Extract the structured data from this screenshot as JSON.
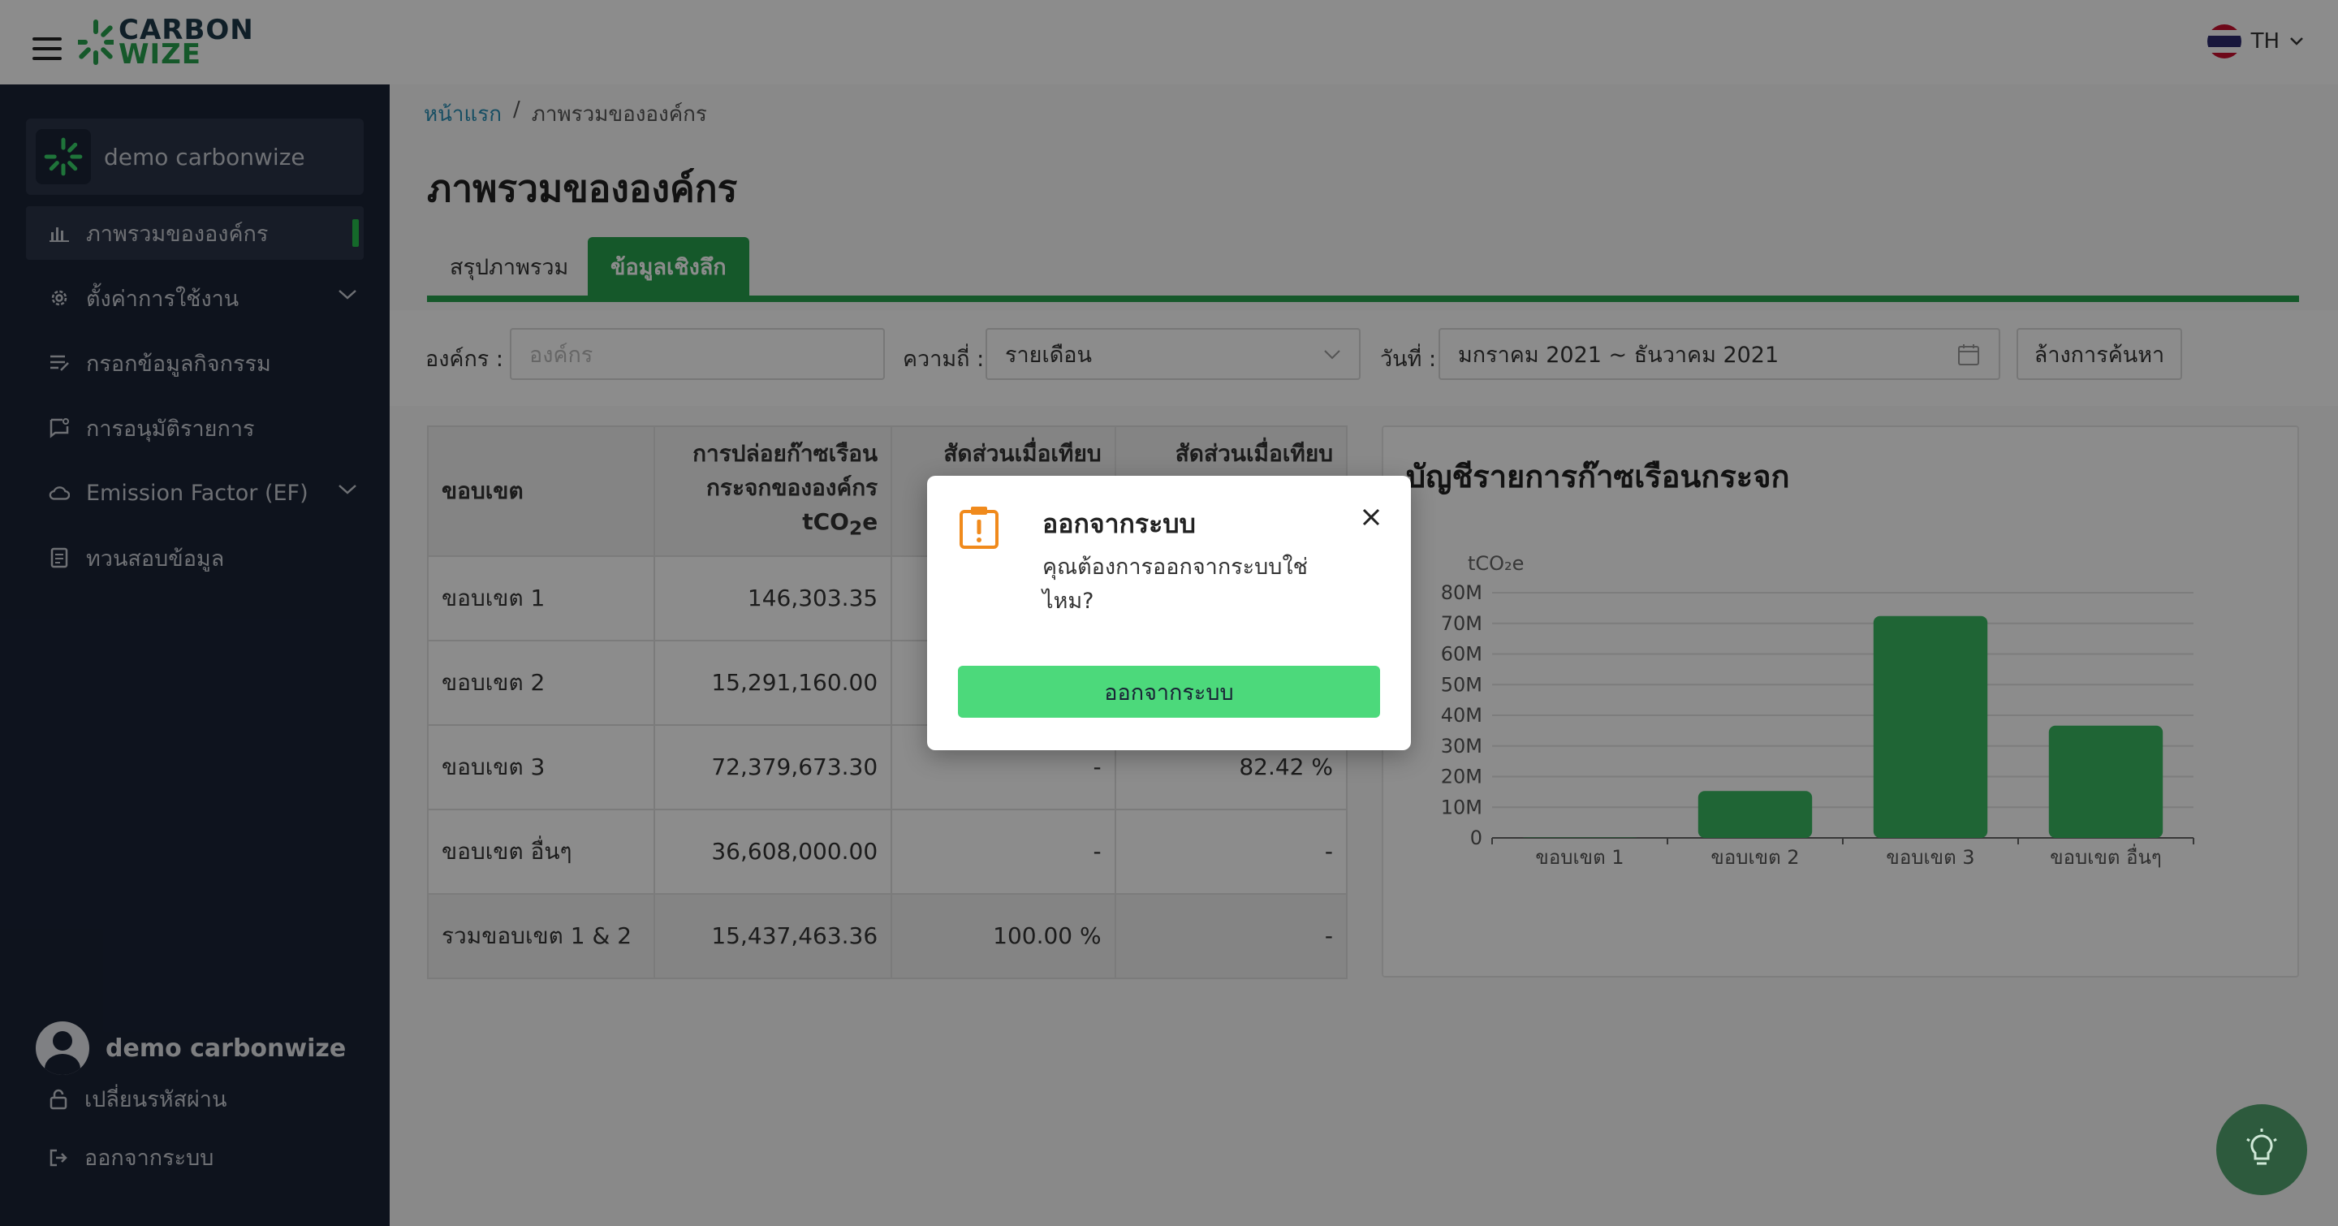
{
  "brand": {
    "line1": "CARBON",
    "line2": "WIZE",
    "accent": "#27a04d",
    "dark": "#1e3a4a"
  },
  "language": {
    "code": "TH",
    "icon": "thai-flag-icon"
  },
  "sidebar": {
    "org_name": "demo carbonwize",
    "items": [
      {
        "label": "ภาพรวมขององค์กร",
        "icon": "bar-chart-icon",
        "active": true
      },
      {
        "label": "ตั้งค่าการใช้งาน",
        "icon": "gear-icon",
        "expandable": true
      },
      {
        "label": "กรอกข้อมูลกิจกรรม",
        "icon": "edit-list-icon"
      },
      {
        "label": "การอนุมัติรายการ",
        "icon": "approval-icon"
      },
      {
        "label": "Emission Factor (EF)",
        "icon": "cloud-icon",
        "expandable": true
      },
      {
        "label": "ทวนสอบข้อมูล",
        "icon": "document-icon"
      }
    ],
    "user_name": "demo carbonwize",
    "change_password": "เปลี่ยนรหัสผ่าน",
    "logout": "ออกจากระบบ"
  },
  "breadcrumb": {
    "home": "หน้าแรก",
    "separator": "/",
    "current": "ภาพรวมขององค์กร"
  },
  "page_title": "ภาพรวมขององค์กร",
  "tabs": [
    {
      "label": "สรุปภาพรวม",
      "active": false
    },
    {
      "label": "ข้อมูลเชิงลึก",
      "active": true
    }
  ],
  "filters": {
    "org_label": "องค์กร :",
    "org_placeholder": "องค์กร",
    "freq_label": "ความถี่ :",
    "freq_value": "รายเดือน",
    "date_label": "วันที่ :",
    "date_value": "มกราคม 2021 ~ ธันวาคม 2021",
    "clear_button": "ล้างการค้นหา"
  },
  "table": {
    "headers": {
      "scope": "ขอบเขต",
      "emission_line1": "การปล่อยก๊าซเรือน",
      "emission_line2": "กระจกขององค์กร",
      "emission_unit_pre": "tCO",
      "emission_unit_sub": "2",
      "emission_unit_post": "e",
      "ratio1": "สัดส่วนเมื่อเทียบ",
      "ratio2": "สัดส่วนเมื่อเทียบ"
    },
    "rows": [
      {
        "scope": "ขอบเขต 1",
        "emission": "146,303.35",
        "ratio1": "",
        "ratio2": ""
      },
      {
        "scope": "ขอบเขต 2",
        "emission": "15,291,160.00",
        "ratio1": "",
        "ratio2": ""
      },
      {
        "scope": "ขอบเขต 3",
        "emission": "72,379,673.30",
        "ratio1": "-",
        "ratio2": "82.42 %"
      },
      {
        "scope": "ขอบเขต อื่นๆ",
        "emission": "36,608,000.00",
        "ratio1": "-",
        "ratio2": "-"
      }
    ],
    "total": {
      "scope": "รวมขอบเขต 1 & 2",
      "emission": "15,437,463.36",
      "ratio1": "100.00 %",
      "ratio2": "-"
    }
  },
  "chart_data": {
    "type": "bar",
    "title": "บัญชีรายการก๊าซเรือนกระจก",
    "ylabel": "tCO₂e",
    "categories": [
      "ขอบเขต 1",
      "ขอบเขต 2",
      "ขอบเขต 3",
      "ขอบเขต อื่นๆ"
    ],
    "values": [
      146303.35,
      15291160.0,
      72379673.3,
      36608000.0
    ],
    "ylim": [
      0,
      80000000
    ],
    "yticks": [
      "0",
      "10M",
      "20M",
      "30M",
      "40M",
      "50M",
      "60M",
      "70M",
      "80M"
    ],
    "grid": true,
    "bar_color": "#3ab862"
  },
  "modal": {
    "title": "ออกจากระบบ",
    "message": "คุณต้องการออกจากระบบใช่ไหม?",
    "confirm": "ออกจากระบบ",
    "icon": "warning-clipboard-icon",
    "icon_color": "#f08a1c"
  },
  "fab": {
    "icon": "lightbulb-icon"
  }
}
